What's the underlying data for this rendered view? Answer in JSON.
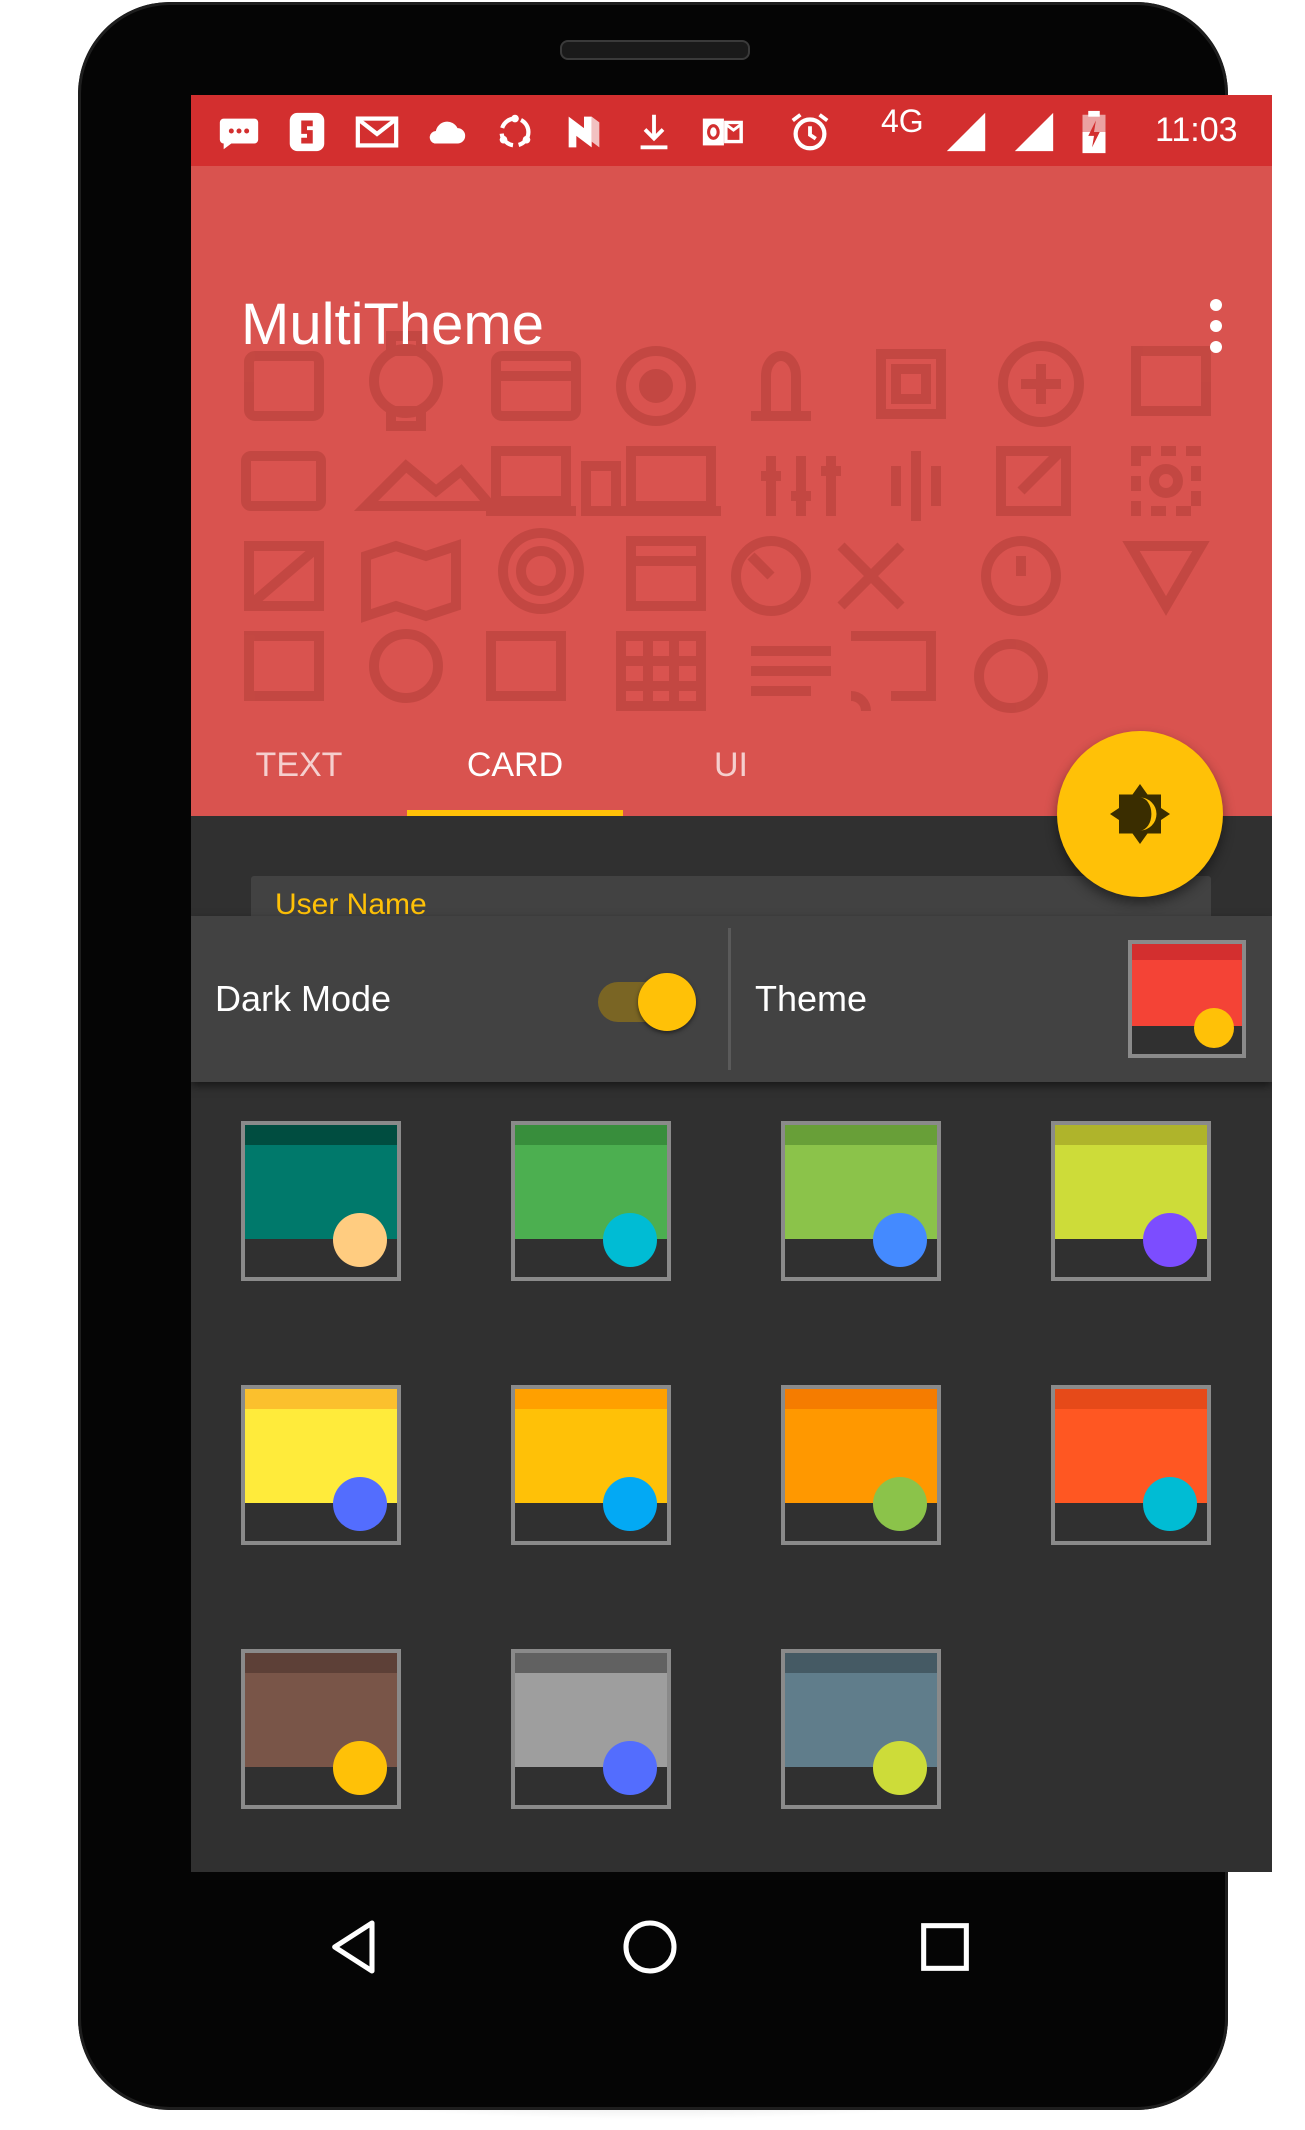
{
  "status_bar": {
    "network_label": "4G",
    "time": "11:03",
    "background": "#d32f2f",
    "icons": [
      "message-icon",
      "app-icon",
      "gmail-icon",
      "cloud-icon",
      "sync-icon",
      "n-icon",
      "download-icon",
      "outlook-icon",
      "alarm-icon",
      "signal-icon",
      "signal-icon",
      "battery-charging-icon"
    ]
  },
  "app_bar": {
    "title": "MultiTheme",
    "background": "#d9534f",
    "tabs": [
      {
        "label": "TEXT",
        "selected": false
      },
      {
        "label": "CARD",
        "selected": true
      },
      {
        "label": "UI",
        "selected": false
      }
    ],
    "indicator_color": "#ffc107"
  },
  "content": {
    "card_peek_label": "User Name",
    "dark_mode_label": "Dark Mode",
    "dark_mode_on": true,
    "theme_label": "Theme",
    "current_theme": {
      "primary": "#f44336",
      "dark": "#d32f2f",
      "accent": "#ffc107"
    },
    "fab_icon": "brightness-icon",
    "themes": [
      {
        "primary": "#00796b",
        "dark": "#004d40",
        "accent": "#ffcc80"
      },
      {
        "primary": "#4caf50",
        "dark": "#388e3c",
        "accent": "#00bcd4"
      },
      {
        "primary": "#8bc34a",
        "dark": "#689f38",
        "accent": "#448aff"
      },
      {
        "primary": "#cddc39",
        "dark": "#afb42b",
        "accent": "#7c4dff"
      },
      {
        "primary": "#ffeb3b",
        "dark": "#fbc02d",
        "accent": "#536dfe"
      },
      {
        "primary": "#ffc107",
        "dark": "#ffa000",
        "accent": "#03a9f4"
      },
      {
        "primary": "#ff9800",
        "dark": "#f57c00",
        "accent": "#8bc34a"
      },
      {
        "primary": "#ff5722",
        "dark": "#e64a19",
        "accent": "#00bcd4"
      },
      {
        "primary": "#795548",
        "dark": "#5d4037",
        "accent": "#ffc107"
      },
      {
        "primary": "#9e9e9e",
        "dark": "#616161",
        "accent": "#536dfe"
      },
      {
        "primary": "#607d8b",
        "dark": "#455a64",
        "accent": "#cddc39"
      }
    ]
  },
  "nav_bar": {
    "icons": [
      "back-icon",
      "home-icon",
      "recents-icon"
    ]
  }
}
